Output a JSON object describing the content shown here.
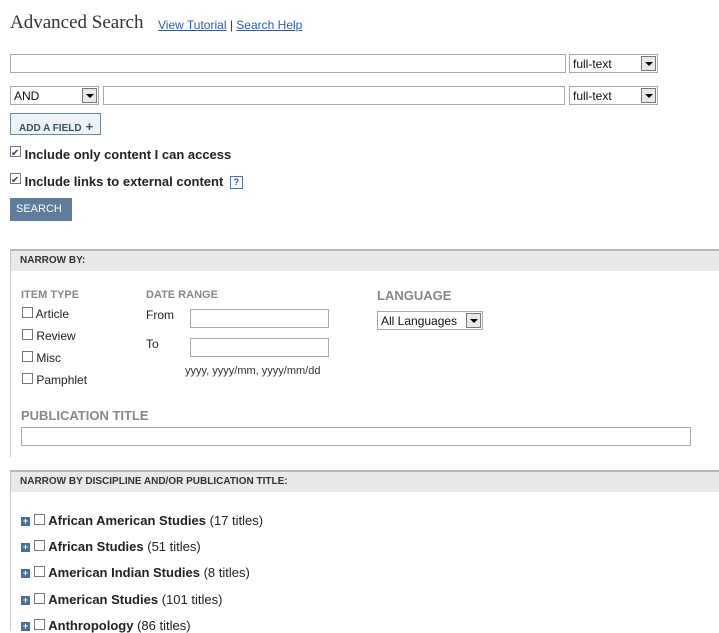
{
  "page": {
    "title": "Advanced Search",
    "view_tutorial": "View Tutorial",
    "separator": "|",
    "search_help": "Search Help"
  },
  "search_rows": [
    {
      "query": "",
      "field": "full-text"
    },
    {
      "operator": "AND",
      "query": "",
      "field": "full-text"
    }
  ],
  "add_field_label": "ADD A FIELD",
  "add_field_icon": "+",
  "options": {
    "only_access": {
      "label": "Include only content I can access",
      "checked": true
    },
    "external_links": {
      "label": "Include links to external content",
      "checked": true,
      "help": "?"
    }
  },
  "search_button": "SEARCH",
  "narrow": {
    "header": "NARROW BY:",
    "item_type_label": "ITEM TYPE",
    "item_types": [
      "Article",
      "Review",
      "Misc",
      "Pamphlet"
    ],
    "date_range_label": "DATE RANGE",
    "from_label": "From",
    "to_label": "To",
    "date_format_hint": "yyyy, yyyy/mm, yyyy/mm/dd",
    "language_label": "LANGUAGE",
    "language_value": "All Languages",
    "publication_title_label": "PUBLICATION TITLE"
  },
  "discipline": {
    "header": "NARROW BY DISCIPLINE AND/OR PUBLICATION TITLE:",
    "items": [
      {
        "name": "African American Studies",
        "count": "(17 titles)"
      },
      {
        "name": "African Studies",
        "count": "(51 titles)"
      },
      {
        "name": "American Indian Studies",
        "count": "(8 titles)"
      },
      {
        "name": "American Studies",
        "count": "(101 titles)"
      },
      {
        "name": "Anthropology",
        "count": "(86 titles)"
      }
    ]
  }
}
